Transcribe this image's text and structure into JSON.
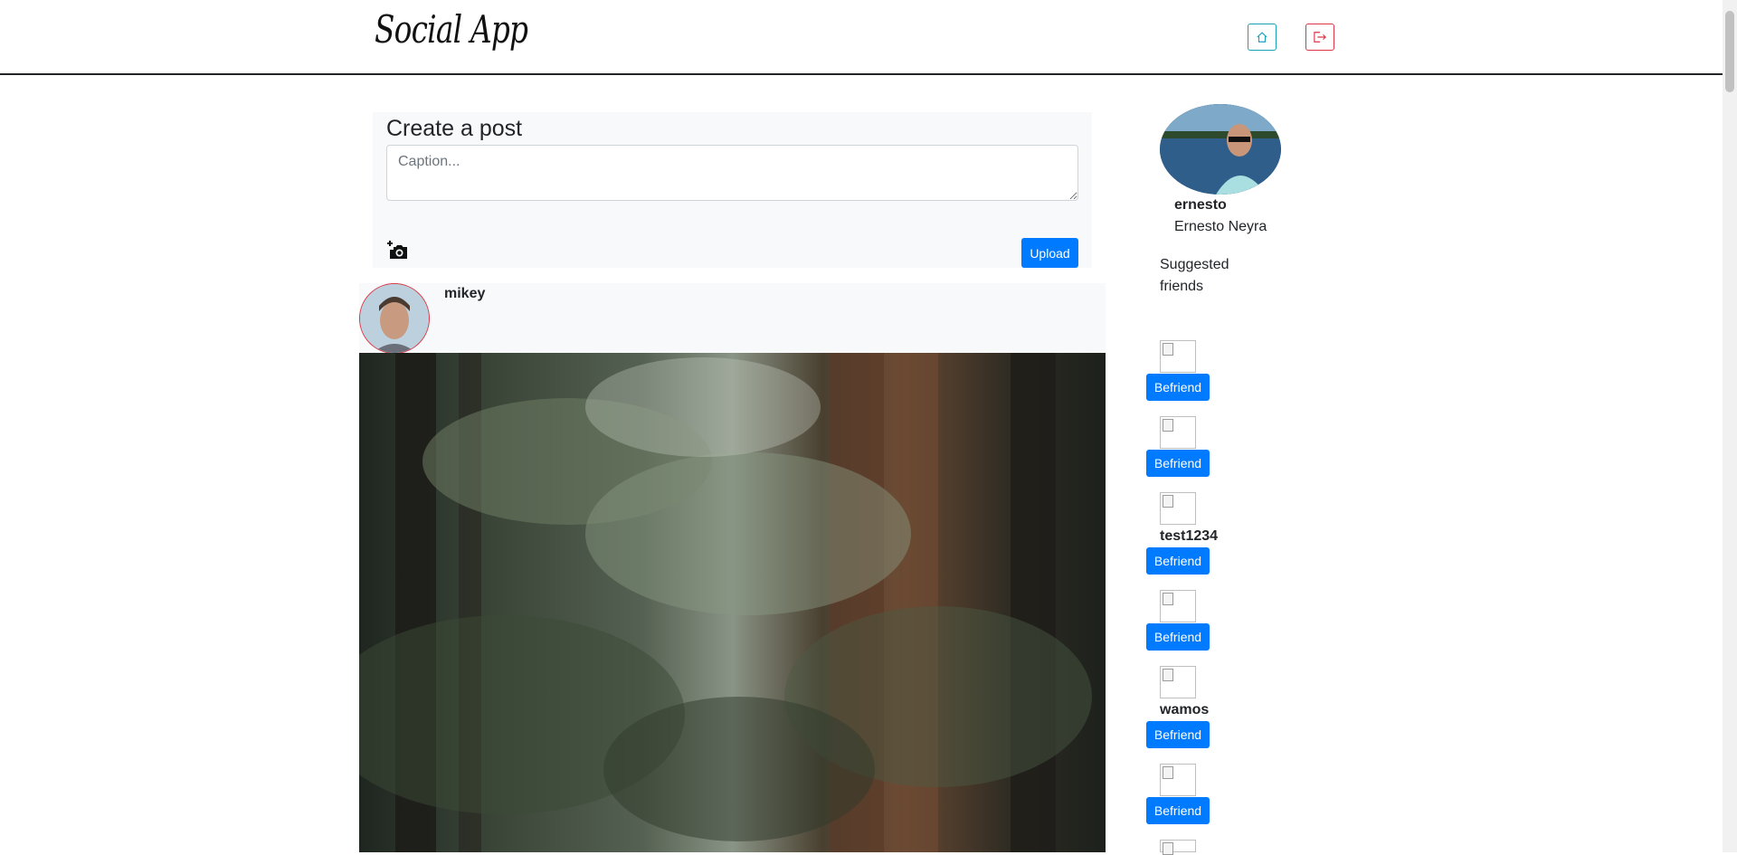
{
  "header": {
    "logo": "Social App",
    "home_icon": "home-icon",
    "logout_icon": "logout-icon"
  },
  "create_post": {
    "title": "Create a post",
    "caption_placeholder": "Caption...",
    "camera_icon": "add-photo-icon",
    "upload_label": "Upload"
  },
  "post": {
    "username": "mikey"
  },
  "sidebar": {
    "username": "ernesto",
    "full_name": "Ernesto Neyra",
    "suggested_title": "Suggested friends",
    "suggestions": [
      {
        "name": "",
        "button": "Befriend"
      },
      {
        "name": "",
        "button": "Befriend"
      },
      {
        "name": "test1234",
        "button": "Befriend"
      },
      {
        "name": "",
        "button": "Befriend"
      },
      {
        "name": "wamos",
        "button": "Befriend"
      },
      {
        "name": "",
        "button": "Befriend"
      }
    ]
  },
  "colors": {
    "primary": "#007bff",
    "info": "#17a2b8",
    "danger": "#dc3545",
    "panel": "#f8f9fa"
  }
}
